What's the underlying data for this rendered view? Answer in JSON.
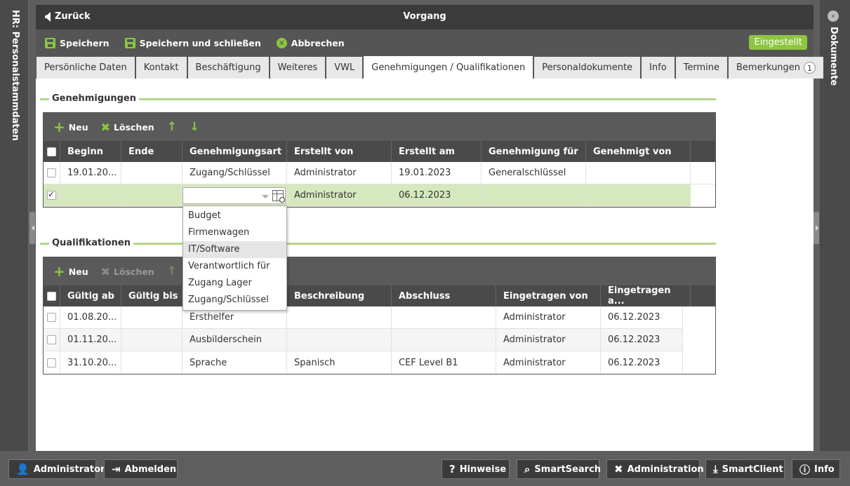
{
  "left_panel": {
    "label": "HR: Personalstammdaten"
  },
  "right_panel": {
    "label": "Dokumente"
  },
  "titlebar": {
    "back_label": "Zurück",
    "title": "Vorgang"
  },
  "toolbar": {
    "save_label": "Speichern",
    "save_close_label": "Speichern und schließen",
    "cancel_label": "Abbrechen",
    "status": "Eingestellt"
  },
  "tabs": [
    {
      "label": "Persönliche Daten"
    },
    {
      "label": "Kontakt"
    },
    {
      "label": "Beschäftigung"
    },
    {
      "label": "Weiteres"
    },
    {
      "label": "VWL"
    },
    {
      "label": "Genehmigungen / Qualifikationen"
    },
    {
      "label": "Personaldokumente"
    },
    {
      "label": "Info"
    },
    {
      "label": "Termine"
    },
    {
      "label": "Bemerkungen",
      "count": "1"
    }
  ],
  "approvals": {
    "section_title": "Genehmigungen",
    "new_label": "Neu",
    "delete_label": "Löschen",
    "columns": [
      "Beginn",
      "Ende",
      "Genehmigungsart",
      "Erstellt von",
      "Erstellt am",
      "Genehmigung für",
      "Genehmigt von"
    ],
    "rows": [
      [
        "19.01.20...",
        "",
        "Zugang/Schlüssel",
        "Administrator",
        "19.01.2023",
        "Generalschlüssel",
        ""
      ],
      [
        "",
        "",
        "",
        "Administrator",
        "06.12.2023",
        "",
        ""
      ]
    ]
  },
  "dropdown": {
    "options": [
      "Budget",
      "Firmenwagen",
      "IT/Software",
      "Verantwortlich für",
      "Zugang Lager",
      "Zugang/Schlüssel"
    ]
  },
  "qualifications": {
    "section_title": "Qualifikationen",
    "new_label": "Neu",
    "delete_label": "Löschen",
    "columns": [
      "Gültig ab",
      "Gültig bis",
      "",
      "Beschreibung",
      "Abschluss",
      "Eingetragen von",
      "Eingetragen a..."
    ],
    "rows": [
      [
        "01.08.20...",
        "",
        "Ersthelfer",
        "",
        "",
        "Administrator",
        "06.12.2023"
      ],
      [
        "01.11.20...",
        "",
        "Ausbilderschein",
        "",
        "",
        "Administrator",
        "06.12.2023"
      ],
      [
        "31.10.20...",
        "",
        "Sprache",
        "Spanisch",
        "CEF Level B1",
        "Administrator",
        "06.12.2023"
      ]
    ]
  },
  "footer": {
    "user_label": "Administrator",
    "logout_label": "Abmelden",
    "hints_label": "Hinweise",
    "smartsearch_label": "SmartSearch",
    "admin_label": "Administration",
    "smartclient_label": "SmartClient",
    "info_label": "Info"
  },
  "colors": {
    "accent": "#8dc63f",
    "dark": "#3b3b3b",
    "selected_row": "#d6e8bd"
  }
}
